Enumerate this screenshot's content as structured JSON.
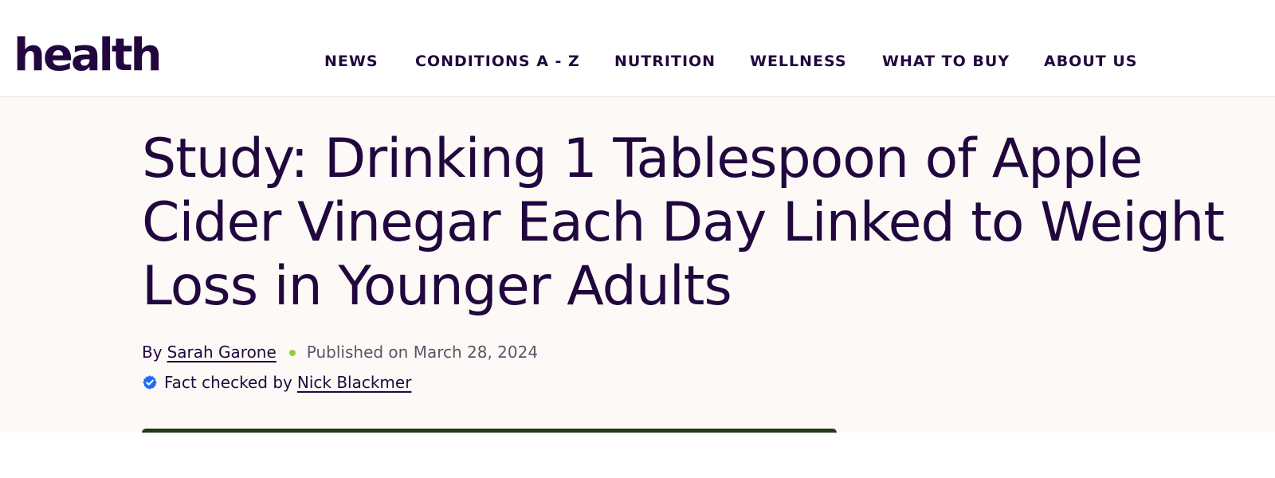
{
  "header": {
    "logo": "health",
    "nav": [
      {
        "label": "NEWS"
      },
      {
        "label": "CONDITIONS A - Z"
      },
      {
        "label": "NUTRITION"
      },
      {
        "label": "WELLNESS"
      },
      {
        "label": "WHAT TO BUY"
      },
      {
        "label": "ABOUT US"
      }
    ]
  },
  "article": {
    "title": "Study: Drinking 1 Tablespoon of Apple Cider Vinegar Each Day Linked to Weight Loss in Younger Adults",
    "by_label": "By",
    "author": "Sarah Garone",
    "published": "Published on March 28, 2024",
    "fact_checked_label": "Fact checked by",
    "fact_checker": "Nick Blackmer"
  },
  "colors": {
    "brand": "#22073f",
    "background": "#fdf9f7",
    "dot_accent": "#8fd13a",
    "verified_blue": "#1f6bf5",
    "hero_green": "#1b3a1b"
  },
  "icons": {
    "verified": "verified-badge-icon",
    "separator": "dot-separator"
  }
}
